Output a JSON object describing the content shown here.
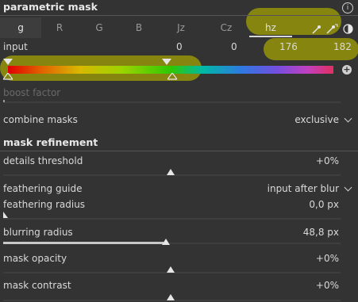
{
  "header": {
    "title": "parametric mask"
  },
  "tabs": [
    {
      "label": "g"
    },
    {
      "label": "R"
    },
    {
      "label": "G"
    },
    {
      "label": "B"
    },
    {
      "label": "Jz"
    },
    {
      "label": "Cz"
    },
    {
      "label": "hz"
    }
  ],
  "input": {
    "label": "input",
    "v1": "0",
    "v2": "0",
    "v3": "176",
    "v4": "182"
  },
  "boost": {
    "label": "boost factor"
  },
  "combine": {
    "label": "combine masks",
    "value": "exclusive"
  },
  "refinement": {
    "title": "mask refinement"
  },
  "rows": {
    "details": {
      "label": "details threshold",
      "value": "+0%",
      "level": 0.5
    },
    "feather_guide": {
      "label": "feathering guide",
      "value": "input after blur"
    },
    "feather_radius": {
      "label": "feathering radius",
      "value": "0,0 px",
      "level": 0.0
    },
    "blur": {
      "label": "blurring radius",
      "value": "48,8 px",
      "level": 0.49
    },
    "opacity": {
      "label": "mask opacity",
      "value": "+0%",
      "level": 0.5
    },
    "contrast": {
      "label": "mask contrast",
      "value": "+0%",
      "level": 0.5
    }
  },
  "colors": {
    "highlight": "#a8a800",
    "background": "#333333"
  }
}
